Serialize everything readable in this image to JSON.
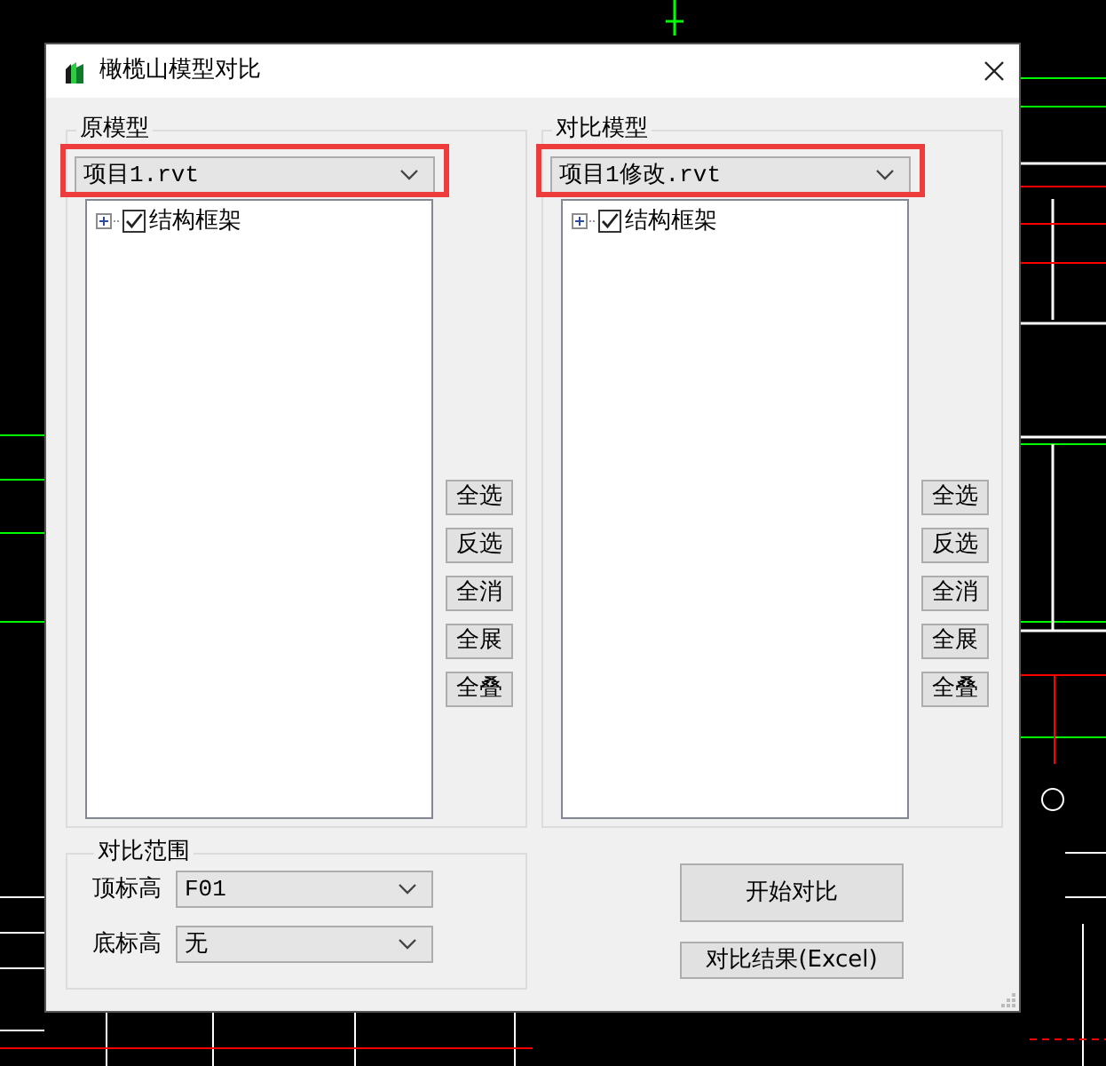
{
  "window": {
    "title": "橄榄山模型对比"
  },
  "panels": [
    {
      "label": "原模型",
      "model": "项目1.rvt",
      "highlighted": true,
      "tree": [
        {
          "label": "结构框架",
          "checked": true,
          "expanded": false
        }
      ],
      "buttons": [
        "全选",
        "反选",
        "全消",
        "全展",
        "全叠"
      ]
    },
    {
      "label": "对比模型",
      "model": "项目1修改.rvt",
      "highlighted": true,
      "tree": [
        {
          "label": "结构框架",
          "checked": true,
          "expanded": false
        }
      ],
      "buttons": [
        "全选",
        "反选",
        "全消",
        "全展",
        "全叠"
      ]
    }
  ],
  "range": {
    "label": "对比范围",
    "fields": [
      {
        "label": "顶标高",
        "value": "F01"
      },
      {
        "label": "底标高",
        "value": "无"
      }
    ]
  },
  "actions": [
    "开始对比",
    "对比结果(Excel)"
  ]
}
